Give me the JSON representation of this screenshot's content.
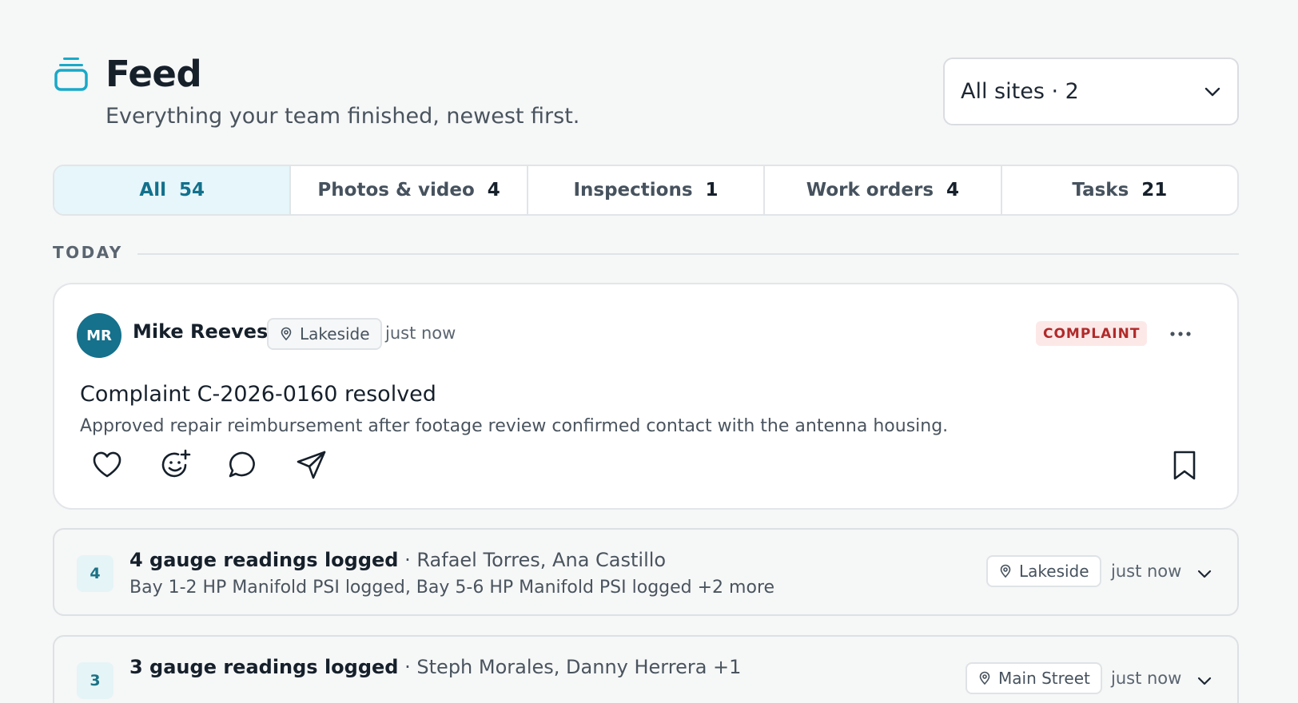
{
  "header": {
    "title": "Feed",
    "subtitle": "Everything your team finished, newest first.",
    "icon": "stack-icon",
    "accent_color": "#19a9c8"
  },
  "site_filter": {
    "value": "All sites · 2",
    "icon": "chevron-down-icon"
  },
  "tabs": [
    {
      "label": "All",
      "count": "54",
      "active": true
    },
    {
      "label": "Photos & video",
      "count": "4"
    },
    {
      "label": "Inspections",
      "count": "1"
    },
    {
      "label": "Work orders",
      "count": "4"
    },
    {
      "label": "Tasks",
      "count": "21"
    }
  ],
  "section": {
    "label": "TODAY"
  },
  "post": {
    "avatar_initials": "MR",
    "avatar_color": "#15718c",
    "author": "Mike Reeves",
    "site": "Lakeside",
    "time": "just now",
    "badge": "COMPLAINT",
    "badge_color": "#b02a2a",
    "title": "Complaint C-2026-0160 resolved",
    "description": "Approved repair reimbursement after footage review confirmed contact with the antenna housing.",
    "actions": [
      "heart-icon",
      "add-reaction-icon",
      "comment-icon",
      "send-icon",
      "bookmark-icon"
    ]
  },
  "groups": [
    {
      "count": "4",
      "title": "4 gauge readings logged",
      "separator": "·",
      "people": "Rafael Torres, Ana Castillo",
      "summary": "Bay 1-2 HP Manifold PSI logged, Bay 5-6 HP Manifold PSI logged +2 more",
      "site": "Lakeside",
      "time": "just now"
    },
    {
      "count": "3",
      "title": "3 gauge readings logged",
      "separator": "·",
      "people": "Steph Morales, Danny Herrera +1",
      "summary": "",
      "site": "Main Street",
      "time": "just now"
    }
  ]
}
